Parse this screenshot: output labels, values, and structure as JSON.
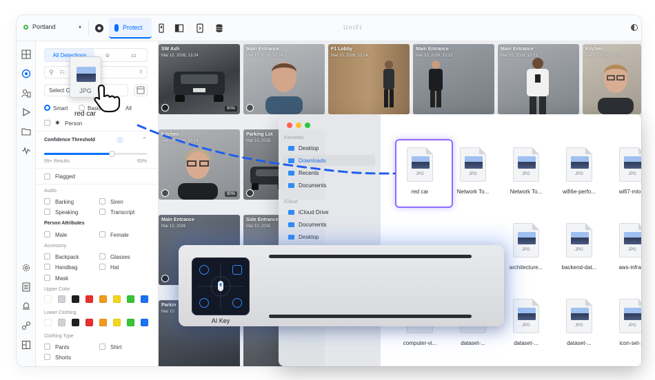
{
  "topbar": {
    "site": "Portland",
    "active_app": "Protect",
    "brand": "UniFi"
  },
  "filters": {
    "tab_all": "All Detections",
    "search_placeholder": "Fi",
    "select_label": "Select C",
    "mode_smart": "Smart",
    "mode_basic": "Basic",
    "mode_all": "All",
    "person": "Person",
    "confidence_title": "Confidence Threshold",
    "results": "99+ Results",
    "confidence_value": "65%",
    "confidence_fraction": 0.65,
    "flagged": "Flagged",
    "audio_title": "Audio",
    "barking": "Barking",
    "siren": "Siren",
    "speaking": "Speaking",
    "transcript": "Transcript",
    "person_attr_title": "Person Attributes",
    "male": "Male",
    "female": "Female",
    "accessory_title": "Accessory",
    "backpack": "Backpack",
    "glasses": "Glasses",
    "handbag": "Handbag",
    "hat": "Hat",
    "mask": "Mask",
    "upper_color_title": "Upper Color",
    "lower_clothing_title": "Lower Clothing",
    "clothing_type_title": "Clothing Type",
    "pants": "Pants",
    "shirt": "Shirt",
    "shorts": "Shorts",
    "colors": [
      "#ffffff",
      "#d0d2d6",
      "#1f1f1f",
      "#e8302c",
      "#f29a1d",
      "#f4d51c",
      "#37c437",
      "#1a73f0"
    ]
  },
  "tiles": [
    {
      "cam": "SW Ash",
      "time": "Mar 10, 2026, 13:24",
      "badge": "90%"
    },
    {
      "cam": "Main Entrance",
      "time": "Mar 10, 2026, 13:24",
      "badge": ""
    },
    {
      "cam": "F1 Lobby",
      "time": "Mar 10, 2026, 13:24",
      "badge": ""
    },
    {
      "cam": "Main Entrance",
      "time": "Mar 10, 2026, 13:22",
      "badge": ""
    },
    {
      "cam": "Main Entrance",
      "time": "Mar 10, 2026, 13:21",
      "badge": ""
    },
    {
      "cam": "Kitchen",
      "time": "Mar 10, 2026, 13:20",
      "badge": ""
    },
    {
      "cam": "Kitchen",
      "time": "Mar 10, 2026, 13:19",
      "badge": "90%"
    },
    {
      "cam": "Parking Lot",
      "time": "Mar 10, 2026",
      "badge": ""
    },
    {
      "cam": "Main Entrance",
      "time": "Mar 10, 2026",
      "badge": ""
    },
    {
      "cam": "Side Entrance",
      "time": "Mar 10, 2026",
      "badge": ""
    },
    {
      "cam": "Parkin",
      "time": "Mar 10",
      "badge": ""
    }
  ],
  "finder": {
    "favorites_title": "Favorites",
    "icloud_title": "iCloud",
    "sidebar": [
      "Desktop",
      "Downloads",
      "Recents",
      "Documents"
    ],
    "icloud_items": [
      "iCloud Drive",
      "Documents",
      "Desktop"
    ],
    "files": [
      "red car",
      "Network To...",
      "Network To...",
      "wifi6e-perfo...",
      "wifi7-mlo...",
      "architecture...",
      "backend-dat...",
      "aws-infra...",
      "computer-vi...",
      "dataset-...",
      "dataset-...",
      "dataset-...",
      "icon-set-..."
    ],
    "file_ext": "JPG"
  },
  "drag": {
    "ext": "JPG",
    "label": "red car"
  },
  "aikey": {
    "label": "AI Key"
  }
}
